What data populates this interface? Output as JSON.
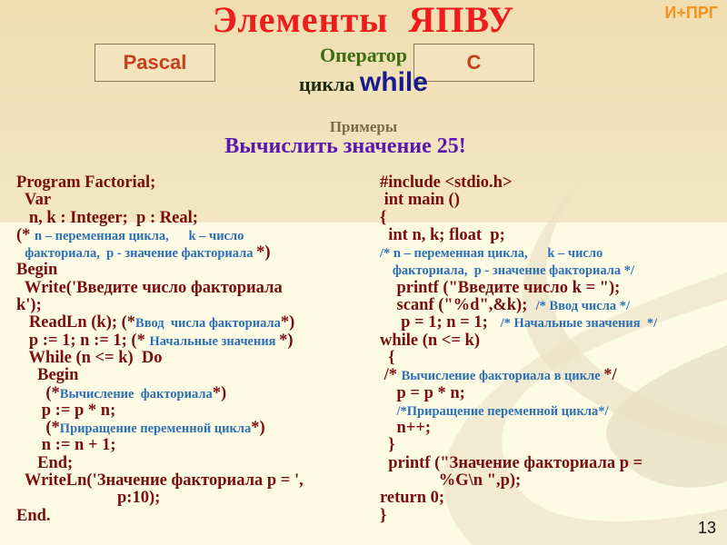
{
  "header": {
    "title": "Элементы  ЯПВУ",
    "corner_label": "И+ПРГ"
  },
  "tabs": {
    "pascal": "Pascal",
    "c": "C"
  },
  "operator": {
    "line1": "Оператор",
    "line2_prefix": "цикла ",
    "keyword": "while"
  },
  "examples_label": "Примеры",
  "task": "Вычислить значение 25!",
  "pascal_code": [
    {
      "segments": [
        {
          "t": "Program Factorial;"
        }
      ]
    },
    {
      "segments": [
        {
          "t": "  Var"
        }
      ]
    },
    {
      "segments": [
        {
          "t": "   n, k : Integer;  p : Real;"
        }
      ]
    },
    {
      "segments": [
        {
          "t": "(* "
        },
        {
          "t": "n – переменная цикла,      k – число",
          "c": true
        }
      ]
    },
    {
      "segments": [
        {
          "t": "  "
        },
        {
          "t": "факториала,  р - значение факториала ",
          "c": true
        },
        {
          "t": "*)"
        }
      ]
    },
    {
      "segments": [
        {
          "t": "Begin"
        }
      ]
    },
    {
      "segments": [
        {
          "t": "  Write('Введите число факториала"
        }
      ]
    },
    {
      "segments": [
        {
          "t": "k');"
        }
      ]
    },
    {
      "segments": [
        {
          "t": "   ReadLn (k); (*"
        },
        {
          "t": "Ввод  числа факториала",
          "c": true
        },
        {
          "t": "*)"
        }
      ]
    },
    {
      "segments": [
        {
          "t": "   p := 1; n := 1; (* "
        },
        {
          "t": "Начальные значения ",
          "c": true
        },
        {
          "t": "*)"
        }
      ]
    },
    {
      "segments": [
        {
          "t": "   While (n <= k)  Do"
        }
      ]
    },
    {
      "segments": [
        {
          "t": "     Begin"
        }
      ]
    },
    {
      "segments": [
        {
          "t": "       (*"
        },
        {
          "t": "Вычисление  факториала",
          "c": true
        },
        {
          "t": "*)"
        }
      ]
    },
    {
      "segments": [
        {
          "t": "      p := p * n;"
        }
      ]
    },
    {
      "segments": [
        {
          "t": "       (*"
        },
        {
          "t": "Приращение переменной цикла",
          "c": true
        },
        {
          "t": "*)"
        }
      ]
    },
    {
      "segments": [
        {
          "t": "      n := n + 1;"
        }
      ]
    },
    {
      "segments": [
        {
          "t": "     End;"
        }
      ]
    },
    {
      "segments": [
        {
          "t": "  WriteLn('Значение факториала p = ',"
        }
      ]
    },
    {
      "segments": [
        {
          "t": "                        p:10);"
        }
      ]
    },
    {
      "segments": [
        {
          "t": "End."
        }
      ]
    }
  ],
  "c_code": [
    {
      "segments": [
        {
          "t": "#include <stdio.h>"
        }
      ]
    },
    {
      "segments": [
        {
          "t": " int main ()"
        }
      ]
    },
    {
      "segments": [
        {
          "t": "{"
        }
      ]
    },
    {
      "segments": [
        {
          "t": "  int n, k; float  p;"
        }
      ]
    },
    {
      "segments": [
        {
          "t": "/* ",
          "c": true
        },
        {
          "t": "n – переменная цикла,      k – число",
          "c": true
        }
      ]
    },
    {
      "segments": [
        {
          "t": "   "
        },
        {
          "t": "факториала,  р - значение факториала */",
          "c": true
        }
      ]
    },
    {
      "segments": [
        {
          "t": "    printf (\"Введите число k = \");"
        }
      ]
    },
    {
      "segments": [
        {
          "t": "    scanf (\"%d\",&k);  "
        },
        {
          "t": "/* Ввод числа */",
          "c": true
        }
      ]
    },
    {
      "segments": [
        {
          "t": "     p = 1; n = 1;   "
        },
        {
          "t": "/* Начальные значения  */",
          "c": true
        }
      ]
    },
    {
      "segments": [
        {
          "t": "while (n <= k)"
        }
      ]
    },
    {
      "segments": [
        {
          "t": "  {"
        }
      ]
    },
    {
      "segments": [
        {
          "t": " /* "
        },
        {
          "t": "Вычисление факториала в цикле ",
          "c": true
        },
        {
          "t": "*/"
        }
      ]
    },
    {
      "segments": [
        {
          "t": "    p = p * n;"
        }
      ]
    },
    {
      "segments": [
        {
          "t": "    "
        },
        {
          "t": "/*Приращение переменной цикла*/",
          "c": true
        }
      ]
    },
    {
      "segments": [
        {
          "t": "    n++;"
        }
      ]
    },
    {
      "segments": [
        {
          "t": "  }"
        }
      ]
    },
    {
      "segments": [
        {
          "t": "  printf (\"Значение факториала p ="
        }
      ]
    },
    {
      "segments": [
        {
          "t": "              %G\\n \",p);"
        }
      ]
    },
    {
      "segments": [
        {
          "t": "return 0;"
        }
      ]
    },
    {
      "segments": [
        {
          "t": "}"
        }
      ]
    }
  ],
  "page_number": "13"
}
